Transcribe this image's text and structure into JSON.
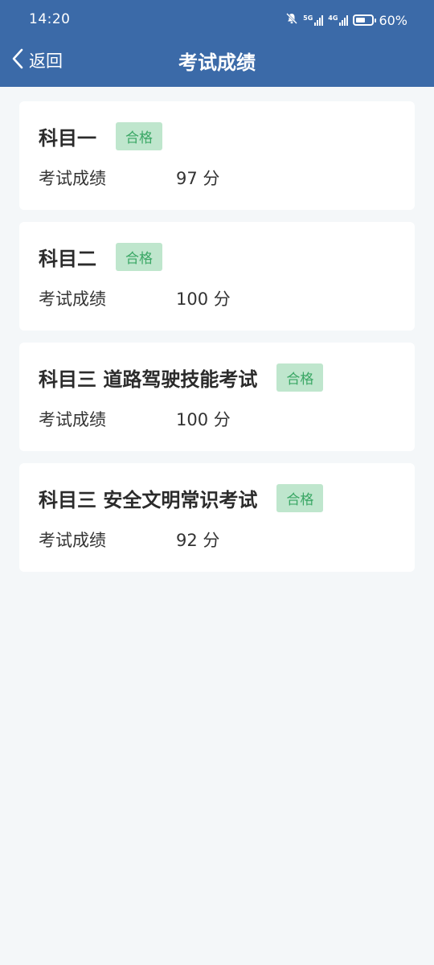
{
  "status_bar": {
    "time": "14:20",
    "network1": "5G",
    "network2": "4G",
    "battery_percent_text": "60%",
    "battery_level": 0.6
  },
  "header": {
    "back_label": "返回",
    "title": "考试成绩"
  },
  "colors": {
    "header_bg": "#3b6aa8",
    "page_bg": "#f4f7f9",
    "badge_bg": "#bfe6cd",
    "badge_text": "#3aa765"
  },
  "results": [
    {
      "subject": "科目一",
      "badge": "合格",
      "score_label": "考试成绩",
      "score": "97 分"
    },
    {
      "subject": "科目二",
      "badge": "合格",
      "score_label": "考试成绩",
      "score": "100 分"
    },
    {
      "subject": "科目三 道路驾驶技能考试",
      "badge": "合格",
      "score_label": "考试成绩",
      "score": "100 分"
    },
    {
      "subject": "科目三 安全文明常识考试",
      "badge": "合格",
      "score_label": "考试成绩",
      "score": "92 分"
    }
  ]
}
